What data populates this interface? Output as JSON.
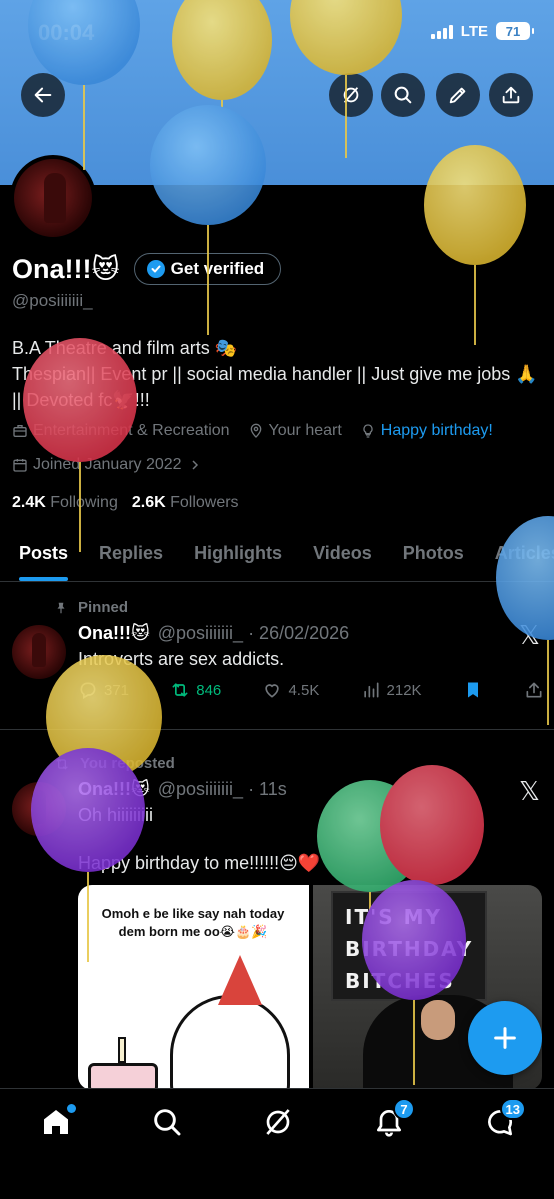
{
  "status": {
    "time": "00:04",
    "network": "LTE",
    "battery": "71"
  },
  "profile": {
    "name": "Ona!!!😻",
    "get_verified": "Get verified",
    "handle": "@posiiiiiii_",
    "bio_line1": "B.A Theatre and film arts 🎭",
    "bio_line2": " Thespian|| Event pr || social media handler || Just give me jobs 🙏 || Devoted fc🦅!!!",
    "category": "Entertainment & Recreation",
    "location": "Your heart",
    "website": "Happy birthday!",
    "joined": "Joined January 2022",
    "following_count": "2.4K",
    "following_label": "Following",
    "followers_count": "2.6K",
    "followers_label": "Followers"
  },
  "tabs": [
    "Posts",
    "Replies",
    "Highlights",
    "Videos",
    "Photos",
    "Articles"
  ],
  "posts": [
    {
      "context": "Pinned",
      "name": "Ona!!!😻",
      "handle_time": "@posiiiiiii_ · 26/02/2026",
      "text": "Introverts are sex addicts.",
      "replies": "371",
      "reposts": "846",
      "likes": "4.5K",
      "views": "212K"
    },
    {
      "context": "You reposted",
      "name": "Ona!!!😻",
      "handle_time": "@posiiiiiii_ · 11s",
      "text1": "Oh hiiiiiiiii",
      "text2": "Happy birthday to me!!!!!!😔❤️",
      "media_caption": "Omoh e be like say nah today dem born me oo😭🎂🎉",
      "media_sign": "IT'S MY BIRTHDAY BITCHES"
    }
  ],
  "bottom_nav": {
    "notifications_badge": "7",
    "messages_badge": "13"
  },
  "colors": {
    "accent": "#1d9bf0",
    "banner": "#4a8fd9",
    "repost": "#00ba7c"
  }
}
